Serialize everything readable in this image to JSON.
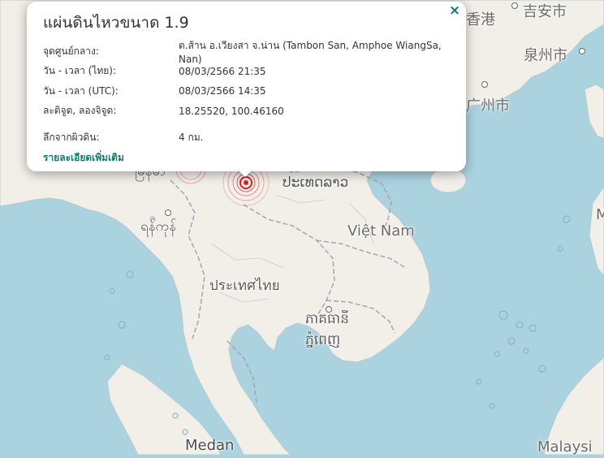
{
  "map": {
    "labels": {
      "hongkong": "香港",
      "guangzhou": "广州市",
      "quanzhou": "泉州市",
      "jian": "吉安市",
      "laos": "ປະເທດລາວ",
      "vietnam": "Việt Nam",
      "thailand": "ประเทศไทย",
      "cambodia": "ភ្នំពេញ",
      "cambodia2": "ភាគធានី",
      "yangon": "ရန်ကုန်",
      "myanmar": "မြန်မာ",
      "medan": "Medan",
      "malaysia": "Malaysi",
      "edge_m": "M"
    },
    "colors": {
      "sea": "#aad3df",
      "land": "#f2efe9",
      "border": "#ac9fb8",
      "quake": "#d62020"
    }
  },
  "popup": {
    "title": "แผ่นดินไหวขนาด 1.9",
    "close": "×",
    "rows": [
      {
        "k": "จุดศูนย์กลาง:",
        "v": "ต.ส้าน อ.เวียงสา จ.น่าน (Tambon San, Amphoe WiangSa, Nan)"
      },
      {
        "k": "วัน - เวลา (ไทย):",
        "v": "08/03/2566 21:35"
      },
      {
        "k": "วัน - เวลา (UTC):",
        "v": "08/03/2566 14:35"
      },
      {
        "k": "ละติจูด, ลองจิจูด:",
        "v": "18.25520, 100.46160"
      },
      {
        "k": "ลึกจากผิวดิน:",
        "v": "4 กม."
      }
    ],
    "more_link": "รายละเอียดเพิ่มเติม"
  }
}
